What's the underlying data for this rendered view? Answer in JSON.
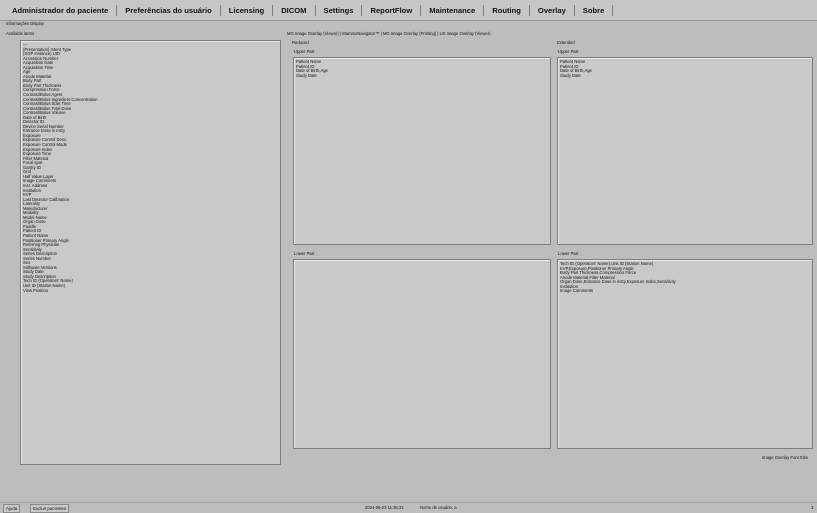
{
  "menu": [
    "Administrador do paciente",
    "Preferências do usuário",
    "Licensing",
    "DICOM",
    "Settings",
    "ReportFlow",
    "Maintenance",
    "Routing",
    "Overlay",
    "Sobre"
  ],
  "section_title": "Informações Display",
  "available_label": "Available items",
  "available_items": [
    "---",
    "(Presentation) Intent Type",
    "(SOP Instance) UID",
    "Accession Number",
    "Acquisition Date",
    "Acquisition Time",
    "Age",
    "Anode Material",
    "Body Part",
    "Body Part Thickness",
    "Compression Force",
    "Contrast/Bolus Agent",
    "Contrast/Bolus Ingredient Concentration",
    "Contrast/Bolus Start Time",
    "Contrast/Bolus Total Dose",
    "Contrast/Bolus Volume",
    "Date of Birth",
    "Detector ID",
    "Device Serial Number",
    "Entrance Dose in mGy",
    "Exposure",
    "Exposure Control Desc.",
    "Exposure Control Mode",
    "Exposure Index",
    "Exposure Time",
    "Filter Material",
    "Focal spot",
    "Gantry ID",
    "Grid",
    "Half Value Layer",
    "Image Comments",
    "Inst. Address",
    "Institution",
    "KVP",
    "Last Detector Calibration",
    "Laterality",
    "Manufacturer",
    "Modality",
    "Model Name",
    "Organ Dose",
    "Paddle",
    "Patient ID",
    "Patient Name",
    "Positioner Primary Angle",
    "Referring Physician",
    "Sensitivity",
    "Series Description",
    "Series Number",
    "Sex",
    "Software Versions",
    "Study Date",
    "Study Description",
    "Tech ID (Operators' Name)",
    "Unit ID (Station Name)",
    "View Position"
  ],
  "tabs": [
    "MG Image Overlay (Viewer)",
    "MammoNavigator™",
    "MG Image Overlay (Printing)",
    "US Image Overlay (Viewer)"
  ],
  "reduced": {
    "label": "Reduced",
    "upper_label": "Upper Part",
    "upper_items": [
      "Patient Name",
      "Patient ID",
      "Date of Birth,Age",
      "Study Date"
    ],
    "lower_label": "Lower Part",
    "lower_items": []
  },
  "extended": {
    "label": "Extended",
    "upper_label": "Upper Part",
    "upper_items": [
      "Patient Name",
      "Patient ID",
      "Date of Birth,Age",
      "Study Date"
    ],
    "lower_label": "Lower Part",
    "lower_items": [
      "Tech ID (Operators' Name),Unit ID (Station Name)",
      "KVP,Exposure,Positioner Primary Angle",
      "Body Part Thickness,Compression Force",
      "Anode Material,Filter Material",
      "Organ Dose,Entrance Dose in mGy,Exposure Index,Sensitivity",
      "Institution",
      "Image Comments"
    ]
  },
  "font_size_button": "Image Overlay Font Size",
  "status": {
    "help": "Ajuda",
    "exclude": "Excluir pacientes",
    "datetime": "2024-09-23   11:35:32",
    "user": "Nome de usuário:  a",
    "corner": "3"
  }
}
